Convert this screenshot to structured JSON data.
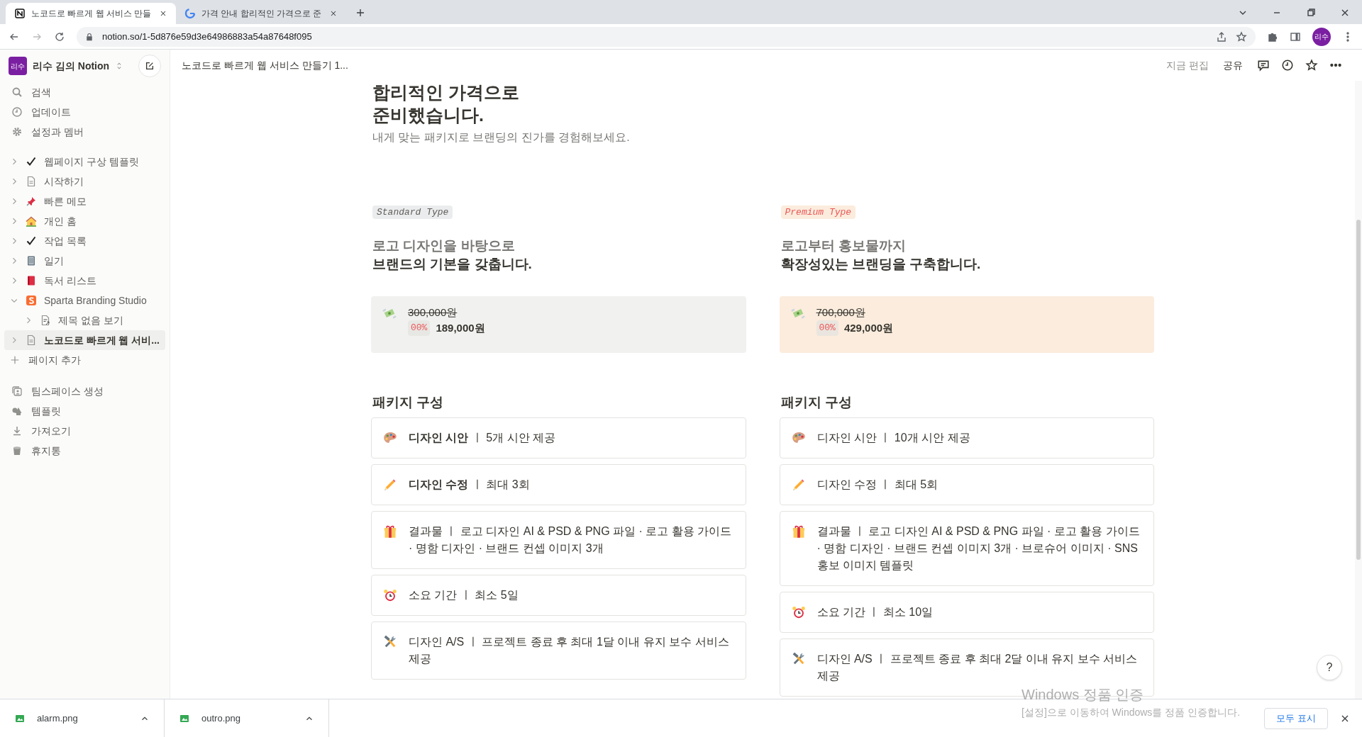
{
  "browser": {
    "tabs": [
      {
        "title": "노코드로 빠르게 웹 서비스 만들",
        "kind": "notion",
        "selected": true
      },
      {
        "title": "가격 안내 합리적인 가격으로 준",
        "kind": "google",
        "selected": false
      }
    ],
    "address": "notion.so/1-5d876e59d3e64986883a54a87648f095",
    "profile": "리수"
  },
  "sidebar": {
    "workspace": {
      "avatar": "리수",
      "name": "리수 김의 Notion"
    },
    "nav": [
      {
        "label": "검색",
        "kind": "search"
      },
      {
        "label": "업데이트",
        "kind": "clock"
      },
      {
        "label": "설정과 멤버",
        "kind": "gear"
      }
    ],
    "pages": [
      {
        "label": "웹페이지 구상 템플릿",
        "kind": "check",
        "expanded": false,
        "selected": false
      },
      {
        "label": "시작하기",
        "kind": "page",
        "expanded": false,
        "selected": false
      },
      {
        "label": "빠른 메모",
        "kind": "pin",
        "expanded": false,
        "selected": false
      },
      {
        "label": "개인 홈",
        "kind": "house",
        "expanded": false,
        "selected": false
      },
      {
        "label": "작업 목록",
        "kind": "check",
        "expanded": false,
        "selected": false
      },
      {
        "label": "일기",
        "kind": "notebook",
        "expanded": false,
        "selected": false
      },
      {
        "label": "독서 리스트",
        "kind": "book",
        "expanded": false,
        "selected": false
      },
      {
        "label": "Sparta Branding Studio",
        "kind": "logo",
        "expanded": true,
        "selected": false,
        "children": [
          {
            "label": "제목 없음 보기",
            "kind": "pagelink",
            "expanded": false,
            "selected": false
          }
        ]
      },
      {
        "label": "노코드로 빠르게 웹 서비...",
        "kind": "page",
        "expanded": false,
        "selected": true
      }
    ],
    "add_page": "페이지 추가",
    "footer": [
      {
        "label": "팀스페이스 생성",
        "kind": "team"
      },
      {
        "label": "템플릿",
        "kind": "shapes"
      },
      {
        "label": "가져오기",
        "kind": "download"
      },
      {
        "label": "휴지통",
        "kind": "trash"
      }
    ]
  },
  "topbar": {
    "breadcrumb": "노코드로 빠르게 웹 서비스 만들기 1...",
    "edited": "지금 편집",
    "share": "공유"
  },
  "page": {
    "title_lines": [
      "합리적인 가격으로",
      "준비했습니다."
    ],
    "subtitle": "내게 맞는 패키지로 브랜딩의 진가를 경험해보세요.",
    "plans": [
      {
        "kind": "standard",
        "tag": "Standard Type",
        "heading_lines": [
          "로고 디자인을 바탕으로",
          "브랜드의 기본을 갖춥니다."
        ],
        "old_price": "300,000원",
        "discount": "00%",
        "price": "189,000원",
        "section_title": "패키지 구성",
        "items": [
          {
            "kind": "palette",
            "text": "**디자인 시안** ㅣ 5개 시안 제공"
          },
          {
            "kind": "pencil",
            "text": "**디자인 수정** ㅣ 최대 3회"
          },
          {
            "kind": "gift",
            "text": "결과물 ㅣ 로고 디자인 AI & PSD & PNG 파일 · 로고 활용 가이드 · 명함 디자인 · 브랜드 컨셉 이미지 3개"
          },
          {
            "kind": "alarm",
            "text": "소요 기간 ㅣ 최소 5일"
          },
          {
            "kind": "tools",
            "text": "디자인 A/S ㅣ 프로젝트 종료 후 최대 1달 이내 유지 보수 서비스 제공"
          }
        ]
      },
      {
        "kind": "premium",
        "tag": "Premium Type",
        "heading_lines": [
          "로고부터 홍보물까지",
          "확장성있는 브랜딩을 구축합니다."
        ],
        "old_price": "700,000원",
        "discount": "00%",
        "price": "429,000원",
        "section_title": "패키지 구성",
        "items": [
          {
            "kind": "palette",
            "text": "디자인 시안 ㅣ 10개 시안 제공"
          },
          {
            "kind": "pencil",
            "text": "디자인 수정 ㅣ 최대 5회"
          },
          {
            "kind": "gift",
            "text": "결과물 ㅣ 로고 디자인 AI & PSD & PNG 파일 · 로고 활용 가이드 · 명함 디자인 · 브랜드 컨셉 이미지 3개 · 브로슈어 이미지 · SNS 홍보 이미지 템플릿"
          },
          {
            "kind": "alarm",
            "text": "소요 기간 ㅣ 최소 10일"
          },
          {
            "kind": "tools",
            "text": "디자인 A/S ㅣ 프로젝트 종료 후 최대 2달 이내 유지 보수 서비스 제공"
          }
        ]
      }
    ]
  },
  "help": "?",
  "watermark": {
    "title": "Windows 정품 인증",
    "text": "[설정]으로 이동하여 Windows를 정품 인증합니다."
  },
  "downloads": {
    "files": [
      "alarm.png",
      "outro.png"
    ],
    "show_all": "모두 표시"
  }
}
